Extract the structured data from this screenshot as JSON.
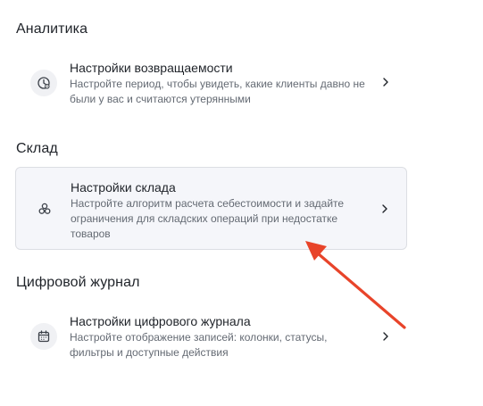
{
  "sections": [
    {
      "title": "Аналитика",
      "item": {
        "title": "Настройки возвращаемости",
        "description": "Настройте период, чтобы увидеть, какие клиенты давно не были у вас и считаются утерянными",
        "icon": "clock-gauge-icon"
      }
    },
    {
      "title": "Склад",
      "item": {
        "title": "Настройки склада",
        "description": "Настройте алгоритм расчета себестоимости и задайте ограничения для складских операций при недостатке товаров",
        "icon": "boxes-icon"
      }
    },
    {
      "title": "Цифровой журнал",
      "item": {
        "title": "Настройки цифрового журнала",
        "description": "Настройте отображение записей: колонки, статусы, фильтры и доступные действия",
        "icon": "calendar-icon"
      }
    }
  ],
  "colors": {
    "annotation_arrow": "#e8442a",
    "highlight_bg": "#f5f6fa"
  }
}
